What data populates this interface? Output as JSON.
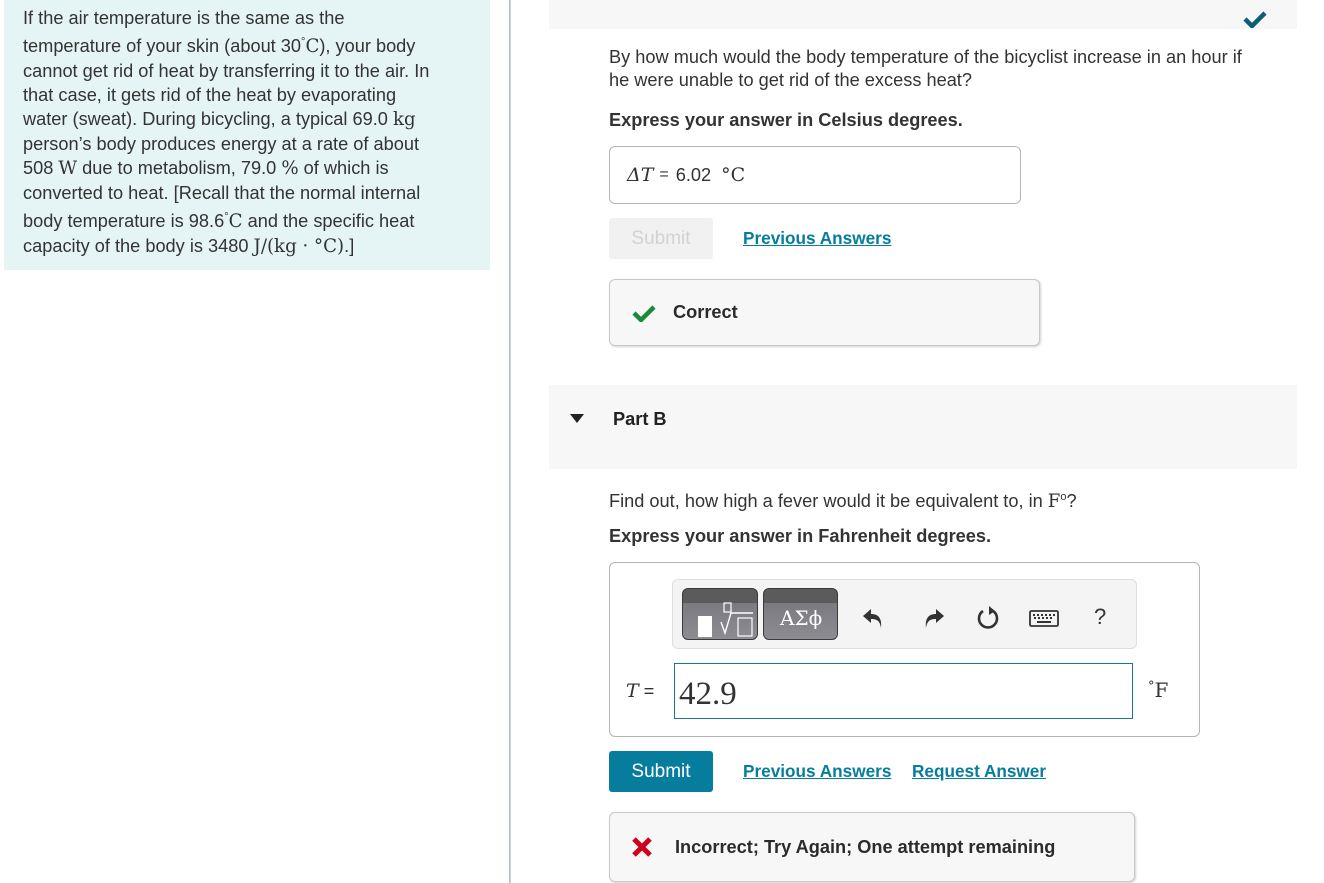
{
  "problem": {
    "line1": "If the air temperature is the same as the",
    "line2_pre": "temperature of your skin (about 30",
    "line2_math": "C",
    "line2_post": "), your body",
    "line3": "cannot get rid of heat by transferring it to the air. In",
    "line4": "that case, it gets rid of the heat by evaporating",
    "line5_pre": "water (sweat). During bicycling, a typical 69.0 ",
    "line5_math": "kg",
    "line6": "person’s body produces energy at a rate of about",
    "line7_pre": "508 ",
    "line7_math": "W",
    "line7_mid": " due to metabolism, 79.0 ",
    "line7_pct": "%",
    "line7_post": " of which is",
    "line8": "converted to heat. [Recall that the normal internal",
    "line9_pre": "body temperature is 98.6",
    "line9_math": "C",
    "line9_post": " and the specific heat",
    "line10_pre": "capacity of the body is 3480 ",
    "line10_math": "J/(kg · °C)",
    "line10_post": ".]",
    "degree": "°"
  },
  "part_a": {
    "status_icon": "checkmark-icon",
    "question_line1": "By how much would the body temperature of the bicyclist increase in an hour if",
    "question_line2": "he were unable to get rid of the excess heat?",
    "instruction": "Express your answer in Celsius degrees.",
    "answer_var": "ΔT",
    "answer_eq": "=",
    "answer_value": "6.02",
    "answer_unit": "°C",
    "submit_label": "Submit",
    "previous_answers_label": "Previous Answers",
    "feedback_icon": "checkmark-icon",
    "feedback_text": "Correct",
    "feedback_color": "#1a8a3a"
  },
  "part_b": {
    "title": "Part B",
    "expand_icon": "caret-down-icon",
    "question_pre": "Find out, how high a fever would it be equivalent to, in ",
    "question_math": "F",
    "question_deg": "o",
    "question_post": "?",
    "instruction": "Express your answer in Fahrenheit degrees.",
    "toolbar": {
      "templates_icon": "fraction-root-template-icon",
      "symbols_label": "ΑΣϕ",
      "undo_icon": "undo-icon",
      "redo_icon": "redo-icon",
      "reset_icon": "reset-icon",
      "keyboard_icon": "keyboard-icon",
      "help_label": "?"
    },
    "answer_var": "T",
    "answer_eq": "=",
    "answer_value": "42.9",
    "unit_deg": "°",
    "unit": "F",
    "submit_label": "Submit",
    "previous_answers_label": "Previous Answers",
    "request_answer_label": "Request Answer",
    "feedback_icon": "x-mark-icon",
    "feedback_text": "Incorrect; Try Again; One attempt remaining",
    "feedback_color": "#d0021b"
  },
  "colors": {
    "accent": "#077d9d",
    "problem_bg": "#e5f5f6",
    "header_bg": "#f7f7f7"
  }
}
